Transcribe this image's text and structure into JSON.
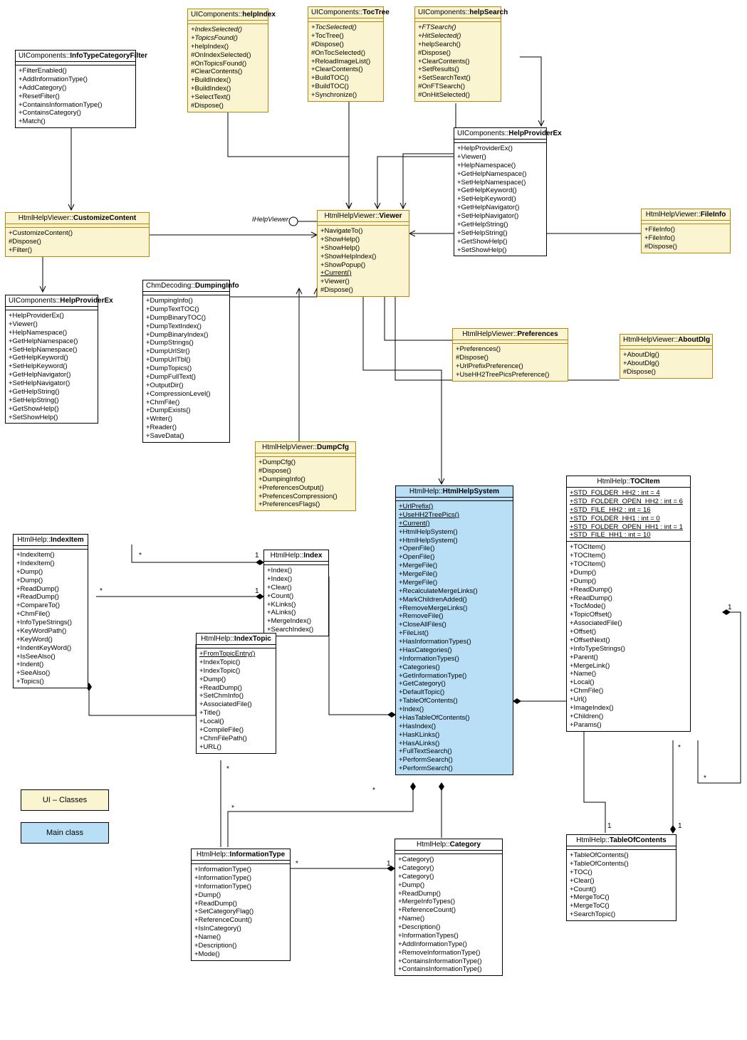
{
  "legend": {
    "ui": "UI – Classes",
    "main": "Main class"
  },
  "interfaceLabel": "IHelpViewer",
  "multiplicities": {
    "one": "1",
    "star": "*"
  },
  "classes": {
    "InfoTypeCategoryFilter": {
      "ns": "UIComponents::",
      "name": "InfoTypeCategoryFilter",
      "methods": [
        "+FilterEnabled()",
        "+AddInformationType()",
        "+AddCategory()",
        "+ResetFilter()",
        "+ContainsInformationType()",
        "+ContainsCategory()",
        "+Match()"
      ]
    },
    "UIhelpIndex": {
      "ns": "UIComponents::",
      "name": "helpIndex",
      "methods": [
        "+IndexSelected()~i",
        "+TopicsFound()~i",
        "+helpIndex()",
        "#OnIndexSelected()",
        "#OnTopicsFound()",
        "#ClearContents()",
        "+BuildIndex()",
        "+BuildIndex()",
        "+SelectText()",
        "#Dispose()"
      ]
    },
    "UITocTree": {
      "ns": "UIComponents::",
      "name": "TocTree",
      "methods": [
        "+TocSelected()~i",
        "+TocTree()",
        "#Dispose()",
        "#OnTocSelected()",
        "+ReloadImageList()",
        "+ClearContents()",
        "+BuildTOC()",
        "+BuildTOC()",
        "+Synchronize()"
      ]
    },
    "UIhelpSearch": {
      "ns": "UIComponents::",
      "name": "helpSearch",
      "methods": [
        "+FTSearch()~i",
        "+HitSelected()~i",
        "+helpSearch()",
        "#Dispose()",
        "+ClearContents()",
        "+SetResults()",
        "+SetSearchText()",
        "#OnFTSearch()",
        "#OnHitSelected()"
      ]
    },
    "CustomizeContent": {
      "ns": "HtmlHelpViewer::",
      "name": "CustomizeContent",
      "methods": [
        "+CustomizeContent()",
        "#Dispose()",
        "+Filter()"
      ]
    },
    "Viewer": {
      "ns": "HtmlHelpViewer::",
      "name": "Viewer",
      "methods": [
        "+NavigateTo()",
        "+ShowHelp()",
        "+ShowHelp()",
        "+ShowHelpIndex()",
        "+ShowPopup()",
        "+Current()~u",
        "+Viewer()",
        "#Dispose()"
      ]
    },
    "HelpProviderEx1": {
      "ns": "UIComponents::",
      "name": "HelpProviderEx",
      "methods": [
        "+HelpProviderEx()",
        "+Viewer()",
        "+HelpNamespace()",
        "+GetHelpNamespace()",
        "+SetHelpNamespace()",
        "+GetHelpKeyword()",
        "+SetHelpKeyword()",
        "+GetHelpNavigator()",
        "+SetHelpNavigator()",
        "+GetHelpString()",
        "+SetHelpString()",
        "+GetShowHelp()",
        "+SetShowHelp()"
      ]
    },
    "FileInfo": {
      "ns": "HtmlHelpViewer::",
      "name": "FileInfo",
      "methods": [
        "+FileInfo()",
        "+FileInfo()",
        "#Dispose()"
      ]
    },
    "DumpingInfo": {
      "ns": "ChmDecoding::",
      "name": "DumpingInfo",
      "methods": [
        "+DumpingInfo()",
        "+DumpTextTOC()",
        "+DumpBinaryTOC()",
        "+DumpTextIndex()",
        "+DumpBinaryIndex()",
        "+DumpStrings()",
        "+DumpUrlStr()",
        "+DumpUrlTbl()",
        "+DumpTopics()",
        "+DumpFullText()",
        "+OutputDir()",
        "+CompressionLevel()",
        "+ChmFile()",
        "+DumpExists()",
        "+Writer()",
        "+Reader()",
        "+SaveData()"
      ]
    },
    "HelpProviderEx2": {
      "ns": "UIComponents::",
      "name": "HelpProviderEx",
      "methods": [
        "+HelpProviderEx()",
        "+Viewer()",
        "+HelpNamespace()",
        "+GetHelpNamespace()",
        "+SetHelpNamespace()",
        "+GetHelpKeyword()",
        "+SetHelpKeyword()",
        "+GetHelpNavigator()",
        "+SetHelpNavigator()",
        "+GetHelpString()",
        "+SetHelpString()",
        "+GetShowHelp()",
        "+SetShowHelp()"
      ]
    },
    "Preferences": {
      "ns": "HtmlHelpViewer::",
      "name": "Preferences",
      "methods": [
        "+Preferences()",
        "#Dispose()",
        "+UrlPrefixPreference()",
        "+UseHH2TreePicsPreference()"
      ]
    },
    "AboutDlg": {
      "ns": "HtmlHelpViewer::",
      "name": "AboutDlg",
      "methods": [
        "+AboutDlg()",
        "+AboutDlg()",
        "#Dispose()"
      ]
    },
    "DumpCfg": {
      "ns": "HtmlHelpViewer::",
      "name": "DumpCfg",
      "methods": [
        "+DumpCfg()",
        "#Dispose()",
        "+DumpingInfo()",
        "+PreferencesOutput()",
        "+PrefencesCompression()",
        "+PreferencesFlags()"
      ]
    },
    "HtmlHelpSystem": {
      "ns": "HtmlHelp::",
      "name": "HtmlHelpSystem",
      "methods": [
        "+UrlPrefix()~u",
        "+UseHH2TreePics()~u",
        "+Current()~u",
        "+HtmlHelpSystem()",
        "+HtmlHelpSystem()",
        "+OpenFile()",
        "+OpenFile()",
        "+MergeFile()",
        "+MergeFile()",
        "+MergeFile()",
        "+RecalculateMergeLinks()",
        "+MarkChildrenAdded()",
        "+RemoveMergeLinks()",
        "+RemoveFile()",
        "+CloseAllFiles()",
        "+FileList()",
        "+HasInformationTypes()",
        "+HasCategories()",
        "+InformationTypes()",
        "+Categories()",
        "+GetInformationType()",
        "+GetCategory()",
        "+DefaultTopic()",
        "+TableOfContents()",
        "+Index()",
        "+HasTableOfContents()",
        "+HasIndex()",
        "+HasKLinks()",
        "+HasALinks()",
        "+FullTextSearch()",
        "+PerformSearch()",
        "+PerformSearch()"
      ]
    },
    "TOCItem": {
      "ns": "HtmlHelp::",
      "name": "TOCItem",
      "attrs": [
        "+STD_FOLDER_HH2 : int = 4~u",
        "+STD_FOLDER_OPEN_HH2 : int = 6~u",
        "+STD_FILE_HH2 : int = 16~u",
        "+STD_FOLDER_HH1 : int = 0~u",
        "+STD_FOLDER_OPEN_HH1 : int = 1~u",
        "+STD_FILE_HH1 : int = 10~u"
      ],
      "methods": [
        "+TOCItem()",
        "+TOCItem()",
        "+TOCItem()",
        "+Dump()",
        "+Dump()",
        "+ReadDump()",
        "+ReadDump()",
        "+TocMode()",
        "+TopicOffset()",
        "+AssociatedFile()",
        "+Offset()",
        "+OffsetNext()",
        "+InfoTypeStrings()",
        "+Parent()",
        "+MergeLink()",
        "+Name()",
        "+Local()",
        "+ChmFile()",
        "+Url()",
        "+ImageIndex()",
        "+Children()",
        "+Params()"
      ]
    },
    "IndexItem": {
      "ns": "HtmlHelp::",
      "name": "IndexItem",
      "methods": [
        "+IndexItem()",
        "+IndexItem()",
        "+Dump()",
        "+Dump()",
        "+ReadDump()",
        "+ReadDump()",
        "+CompareTo()",
        "+ChmFile()",
        "+InfoTypeStrings()",
        "+KeyWordPath()",
        "+KeyWord()",
        "+IndentKeyWord()",
        "+IsSeeAlso()",
        "+Indent()",
        "+SeeAlso()",
        "+Topics()"
      ]
    },
    "Index": {
      "ns": "HtmlHelp::",
      "name": "Index",
      "methods": [
        "+Index()",
        "+Index()",
        "+Clear()",
        "+Count()",
        "+KLinks()",
        "+ALinks()",
        "+MergeIndex()",
        "+SearchIndex()"
      ]
    },
    "IndexTopic": {
      "ns": "HtmlHelp::",
      "name": "IndexTopic",
      "methods": [
        "+FromTopicEntry()~u",
        "+IndexTopic()",
        "+IndexTopic()",
        "+Dump()",
        "+ReadDump()",
        "+SetChmInfo()",
        "+AssociatedFile()",
        "+Title()",
        "+Local()",
        "+CompileFile()",
        "+ChmFilePath()",
        "+URL()"
      ]
    },
    "InformationType": {
      "ns": "HtmlHelp::",
      "name": "InformationType",
      "methods": [
        "+InformationType()",
        "+InformationType()",
        "+InformationType()",
        "+Dump()",
        "+ReadDump()",
        "+SetCategoryFlag()",
        "+ReferenceCount()",
        "+IsInCategory()",
        "+Name()",
        "+Description()",
        "+Mode()"
      ]
    },
    "Category": {
      "ns": "HtmlHelp::",
      "name": "Category",
      "methods": [
        "+Category()",
        "+Category()",
        "+Category()",
        "+Dump()",
        "+ReadDump()",
        "+MergeInfoTypes()",
        "+ReferenceCount()",
        "+Name()",
        "+Description()",
        "+InformationTypes()",
        "+AddInformationType()",
        "+RemoveInformationType()",
        "+ContainsInformationType()",
        "+ContainsInformationType()"
      ]
    },
    "TableOfContents": {
      "ns": "HtmlHelp::",
      "name": "TableOfContents",
      "methods": [
        "+TableOfContents()",
        "+TableOfContents()",
        "+TOC()",
        "+Clear()",
        "+Count()",
        "+MergeToC()",
        "+MergeToC()",
        "+SearchTopic()"
      ]
    }
  }
}
